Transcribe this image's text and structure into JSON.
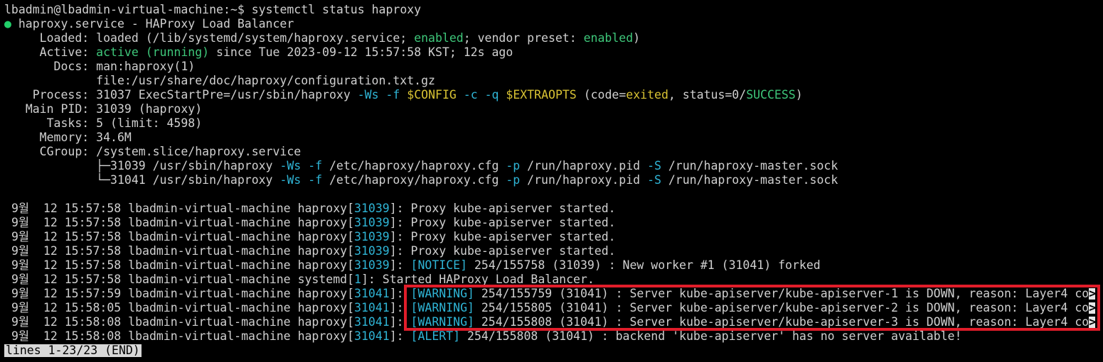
{
  "prompt": {
    "user_host": "lbadmin@lbadmin-virtual-machine:~$",
    "command": "systemctl status haproxy"
  },
  "service": {
    "dot": "●",
    "header": "haproxy.service - HAProxy Load Balancer",
    "loaded": {
      "label": "Loaded:",
      "pre": "loaded (/lib/systemd/system/haproxy.service; ",
      "enabled": "enabled",
      "mid": "; vendor preset: ",
      "preset": "enabled",
      "post": ")"
    },
    "active": {
      "label": "Active:",
      "state": "active (running)",
      "since": "since Tue 2023-09-12 15:57:58 KST; 12s ago"
    },
    "docs": {
      "label": "Docs:",
      "line1": "man:haproxy(1)",
      "line2": "file:/usr/share/doc/haproxy/configuration.txt.gz"
    },
    "process": {
      "label": "Process:",
      "pre": "31037 ExecStartPre=/usr/sbin/haproxy ",
      "flag_ws": "-Ws",
      "flag_f": "-f",
      "var_config": "$CONFIG",
      "flag_c": "-c",
      "flag_q": "-q",
      "var_extra": "$EXTRAOPTS",
      "code_pre": "(code=",
      "code": "exited",
      "status_pre": ", status=0/",
      "status": "SUCCESS",
      "close": ")"
    },
    "main_pid": {
      "label": "Main PID:",
      "value": "31039 (haproxy)"
    },
    "tasks": {
      "label": "Tasks:",
      "value": "5 (limit: 4598)"
    },
    "memory": {
      "label": "Memory:",
      "value": "34.6M"
    },
    "cgroup": {
      "label": "CGroup:",
      "value": "/system.slice/haproxy.service",
      "procs": [
        {
          "tree": "├─",
          "pid_cmd": "31039 /usr/sbin/haproxy ",
          "ws": "-Ws",
          "f": "-f",
          "cfg": "/etc/haproxy/haproxy.cfg",
          "p": "-p",
          "pidfile": "/run/haproxy.pid",
          "S": "-S",
          "sock": "/run/haproxy-master.sock"
        },
        {
          "tree": "└─",
          "pid_cmd": "31041 /usr/sbin/haproxy ",
          "ws": "-Ws",
          "f": "-f",
          "cfg": "/etc/haproxy/haproxy.cfg",
          "p": "-p",
          "pidfile": "/run/haproxy.pid",
          "S": "-S",
          "sock": "/run/haproxy-master.sock"
        }
      ]
    }
  },
  "logs": [
    {
      "date": "9월  12 15:57:58",
      "host": "lbadmin-virtual-machine",
      "proc": "haproxy",
      "pid": "31039",
      "tag": "",
      "msg": ": Proxy kube-apiserver started."
    },
    {
      "date": "9월  12 15:57:58",
      "host": "lbadmin-virtual-machine",
      "proc": "haproxy",
      "pid": "31039",
      "tag": "",
      "msg": ": Proxy kube-apiserver started."
    },
    {
      "date": "9월  12 15:57:58",
      "host": "lbadmin-virtual-machine",
      "proc": "haproxy",
      "pid": "31039",
      "tag": "",
      "msg": ": Proxy kube-apiserver started."
    },
    {
      "date": "9월  12 15:57:58",
      "host": "lbadmin-virtual-machine",
      "proc": "haproxy",
      "pid": "31039",
      "tag": "",
      "msg": ": Proxy kube-apiserver started."
    },
    {
      "date": "9월  12 15:57:58",
      "host": "lbadmin-virtual-machine",
      "proc": "haproxy",
      "pid": "31039",
      "tag": "[NOTICE]",
      "msg": " 254/155758 (31039) : New worker #1 (31041) forked"
    },
    {
      "date": "9월  12 15:57:58",
      "host": "lbadmin-virtual-machine",
      "proc": "systemd",
      "pid": "1",
      "tag": "",
      "msg": ": Started HAProxy Load Balancer."
    },
    {
      "date": "9월  12 15:57:59",
      "host": "lbadmin-virtual-machine",
      "proc": "haproxy",
      "pid": "31041",
      "tag": "[WARNING]",
      "msg": " 254/155759 (31041) : Server kube-apiserver/kube-apiserver-1 is DOWN, reason: Layer4 co",
      "trunc": ">"
    },
    {
      "date": "9월  12 15:58:05",
      "host": "lbadmin-virtual-machine",
      "proc": "haproxy",
      "pid": "31041",
      "tag": "[WARNING]",
      "msg": " 254/155805 (31041) : Server kube-apiserver/kube-apiserver-2 is DOWN, reason: Layer4 co",
      "trunc": ">"
    },
    {
      "date": "9월  12 15:58:08",
      "host": "lbadmin-virtual-machine",
      "proc": "haproxy",
      "pid": "31041",
      "tag": "[WARNING]",
      "msg": " 254/155808 (31041) : Server kube-apiserver/kube-apiserver-3 is DOWN, reason: Layer4 co",
      "trunc": ">"
    },
    {
      "date": "9월  12 15:58:08",
      "host": "lbadmin-virtual-machine",
      "proc": "haproxy",
      "pid": "31041",
      "tag": "[ALERT]",
      "msg": " 254/155808 (31041) : backend 'kube-apiserver' has no server available!"
    }
  ],
  "pager": {
    "status": "lines 1-23/23 (END)"
  },
  "colors": {
    "background": "#000000",
    "text": "#d0d0d0",
    "green": "#3ec77a",
    "cyan": "#2fb5d6",
    "yellow": "#d8c233",
    "highlight_box": "#e11d2a"
  }
}
